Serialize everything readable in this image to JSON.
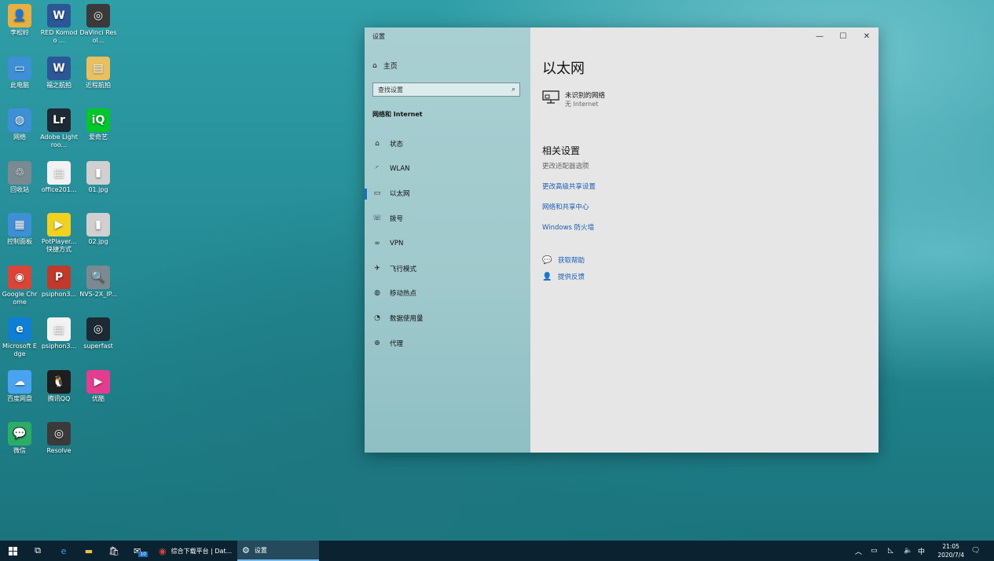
{
  "desktop": {
    "icons": [
      {
        "label": "李松岭",
        "glyph": "👤",
        "color": "#e8b040"
      },
      {
        "label": "RED Komodo ...",
        "glyph": "W",
        "color": "#2b5797"
      },
      {
        "label": "DaVinci Resol...",
        "glyph": "◎",
        "color": "#3a3a3a"
      },
      {
        "label": "此电脑",
        "glyph": "▭",
        "color": "#3d8fd6"
      },
      {
        "label": "福之航拍",
        "glyph": "W",
        "color": "#2b5797"
      },
      {
        "label": "近程航拍",
        "glyph": "▤",
        "color": "#e8c060"
      },
      {
        "label": "网络",
        "glyph": "◍",
        "color": "#3d8fd6"
      },
      {
        "label": "Adobe Lightroo...",
        "glyph": "Lr",
        "color": "#1e2a33"
      },
      {
        "label": "爱奇艺",
        "glyph": "iQ",
        "color": "#00c72a"
      },
      {
        "label": "回收站",
        "glyph": "♲",
        "color": "#7a8a90"
      },
      {
        "label": "office201...",
        "glyph": "▤",
        "color": "#f2f2f2"
      },
      {
        "label": "01.jpg",
        "glyph": "▮",
        "color": "#d0d0d0"
      },
      {
        "label": "控制面板",
        "glyph": "▦",
        "color": "#3d8fd6"
      },
      {
        "label": "PotPlayer... 快捷方式",
        "glyph": "▶",
        "color": "#f0d020"
      },
      {
        "label": "02.jpg",
        "glyph": "▮",
        "color": "#d0d0d0"
      },
      {
        "label": "Google Chrome",
        "glyph": "◉",
        "color": "#db4437"
      },
      {
        "label": "psiphon3...",
        "glyph": "P",
        "color": "#c0392b"
      },
      {
        "label": "NVS-2X_IP...",
        "glyph": "🔍",
        "color": "#7a8a90"
      },
      {
        "label": "Microsoft Edge",
        "glyph": "e",
        "color": "#0f7fd6"
      },
      {
        "label": "psiphon3...",
        "glyph": "▤",
        "color": "#f2f2f2"
      },
      {
        "label": "superfast",
        "glyph": "◎",
        "color": "#1e2a33"
      },
      {
        "label": "百度网盘",
        "glyph": "☁",
        "color": "#4aa3f0"
      },
      {
        "label": "腾讯QQ",
        "glyph": "🐧",
        "color": "#1e1e1e"
      },
      {
        "label": "优酷",
        "glyph": "▶",
        "color": "#e43c8e"
      },
      {
        "label": "微信",
        "glyph": "💬",
        "color": "#2aae67"
      },
      {
        "label": "Resolve",
        "glyph": "◎",
        "color": "#3a3a3a"
      }
    ]
  },
  "window": {
    "title": "设置",
    "controls": {
      "minimize": "—",
      "maximize": "☐",
      "close": "✕"
    },
    "sidebar": {
      "home_label": "主页",
      "search_placeholder": "查找设置",
      "section_title": "网络和 Internet",
      "items": [
        {
          "label": "状态",
          "glyph": "⌂"
        },
        {
          "label": "WLAN",
          "glyph": "◜"
        },
        {
          "label": "以太网",
          "glyph": "▭"
        },
        {
          "label": "拨号",
          "glyph": "☏"
        },
        {
          "label": "VPN",
          "glyph": "∞"
        },
        {
          "label": "飞行模式",
          "glyph": "✈"
        },
        {
          "label": "移动热点",
          "glyph": "◍"
        },
        {
          "label": "数据使用量",
          "glyph": "◔"
        },
        {
          "label": "代理",
          "glyph": "⊕"
        }
      ],
      "active_index": 2
    },
    "main": {
      "title": "以太网",
      "network_name": "未识别的网络",
      "network_status": "无 Internet",
      "related_title": "相关设置",
      "links": [
        {
          "label": "更改适配器选项",
          "disabled": true
        },
        {
          "label": "更改高级共享设置",
          "disabled": false
        },
        {
          "label": "网络和共享中心",
          "disabled": false
        },
        {
          "label": "Windows 防火墙",
          "disabled": false
        }
      ],
      "help": [
        {
          "label": "获取帮助",
          "glyph": "💬"
        },
        {
          "label": "提供反馈",
          "glyph": "👤"
        }
      ]
    }
  },
  "taskbar": {
    "apps": [
      {
        "label": "综合下载平台 | Dat...",
        "active": false
      },
      {
        "label": "设置",
        "active": true
      }
    ],
    "mail_badge": "10",
    "tray": {
      "ime": "中",
      "time": "21:05",
      "date": "2020/7/4"
    }
  }
}
